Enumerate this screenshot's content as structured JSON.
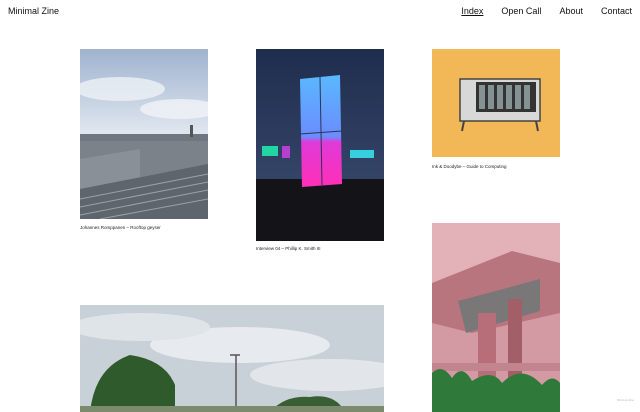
{
  "site": {
    "title": "Minimal Zine"
  },
  "nav": {
    "items": [
      {
        "label": "Index",
        "active": true
      },
      {
        "label": "Open Call",
        "active": false
      },
      {
        "label": "About",
        "active": false
      },
      {
        "label": "Contact",
        "active": false
      }
    ]
  },
  "grid": {
    "items": [
      {
        "caption": "Johannes Romppanen – Rooftop geyser"
      },
      {
        "caption": "Interview 04 – Phillip K. Smith III"
      },
      {
        "caption": "Ink & Doodybe – Guide to Computing"
      },
      {
        "caption": ""
      },
      {
        "caption": ""
      }
    ]
  },
  "footer": {
    "credit": "Minimal Zine"
  }
}
